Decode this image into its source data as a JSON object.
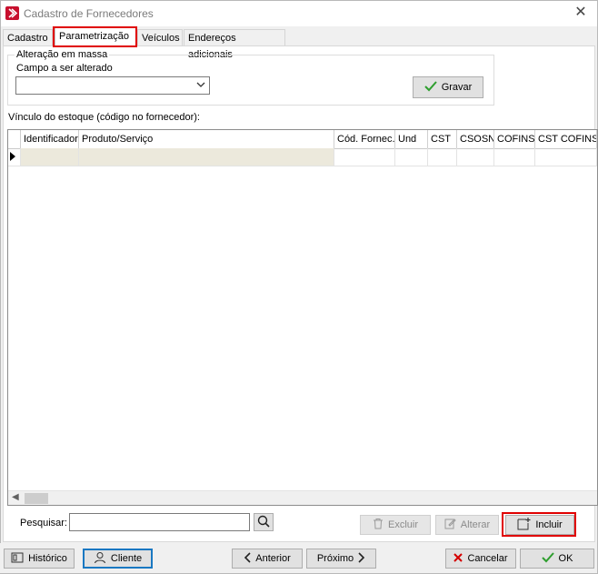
{
  "window": {
    "title": "Cadastro de Fornecedores",
    "close_symbol": "✕"
  },
  "tabs": [
    {
      "label": "Cadastro",
      "active": false
    },
    {
      "label": "Parametrização",
      "active": true
    },
    {
      "label": "Veículos",
      "active": false
    },
    {
      "label": "Endereços adicionais",
      "active": false
    }
  ],
  "mass_edit": {
    "legend": "Alteração em massa",
    "field_label": "Campo a ser alterado",
    "field_value": "",
    "save_label": "Gravar"
  },
  "stock_link": {
    "label": "Vínculo do estoque  (código no fornecedor):",
    "columns": [
      "Identificador",
      "Produto/Serviço",
      "Cód. Fornec.",
      "Und",
      "CST",
      "CSOSN",
      "COFINS",
      "CST COFINS"
    ],
    "rows": [
      [
        "",
        "",
        "",
        "",
        "",
        "",
        "",
        ""
      ]
    ]
  },
  "search": {
    "label": "Pesquisar:",
    "value": ""
  },
  "actions": {
    "delete_label": "Excluir",
    "edit_label": "Alterar",
    "add_label": "Incluir"
  },
  "footer": {
    "history_label": "Histórico",
    "client_label": "Cliente",
    "previous_label": "Anterior",
    "next_label": "Próximo",
    "cancel_label": "Cancelar",
    "ok_label": "OK"
  },
  "colors": {
    "highlight_red": "#e00000",
    "accent_blue": "#1a78c2",
    "selected_row": "#ece9dc",
    "check_green": "#2e9e2e",
    "cancel_red": "#d40000"
  }
}
